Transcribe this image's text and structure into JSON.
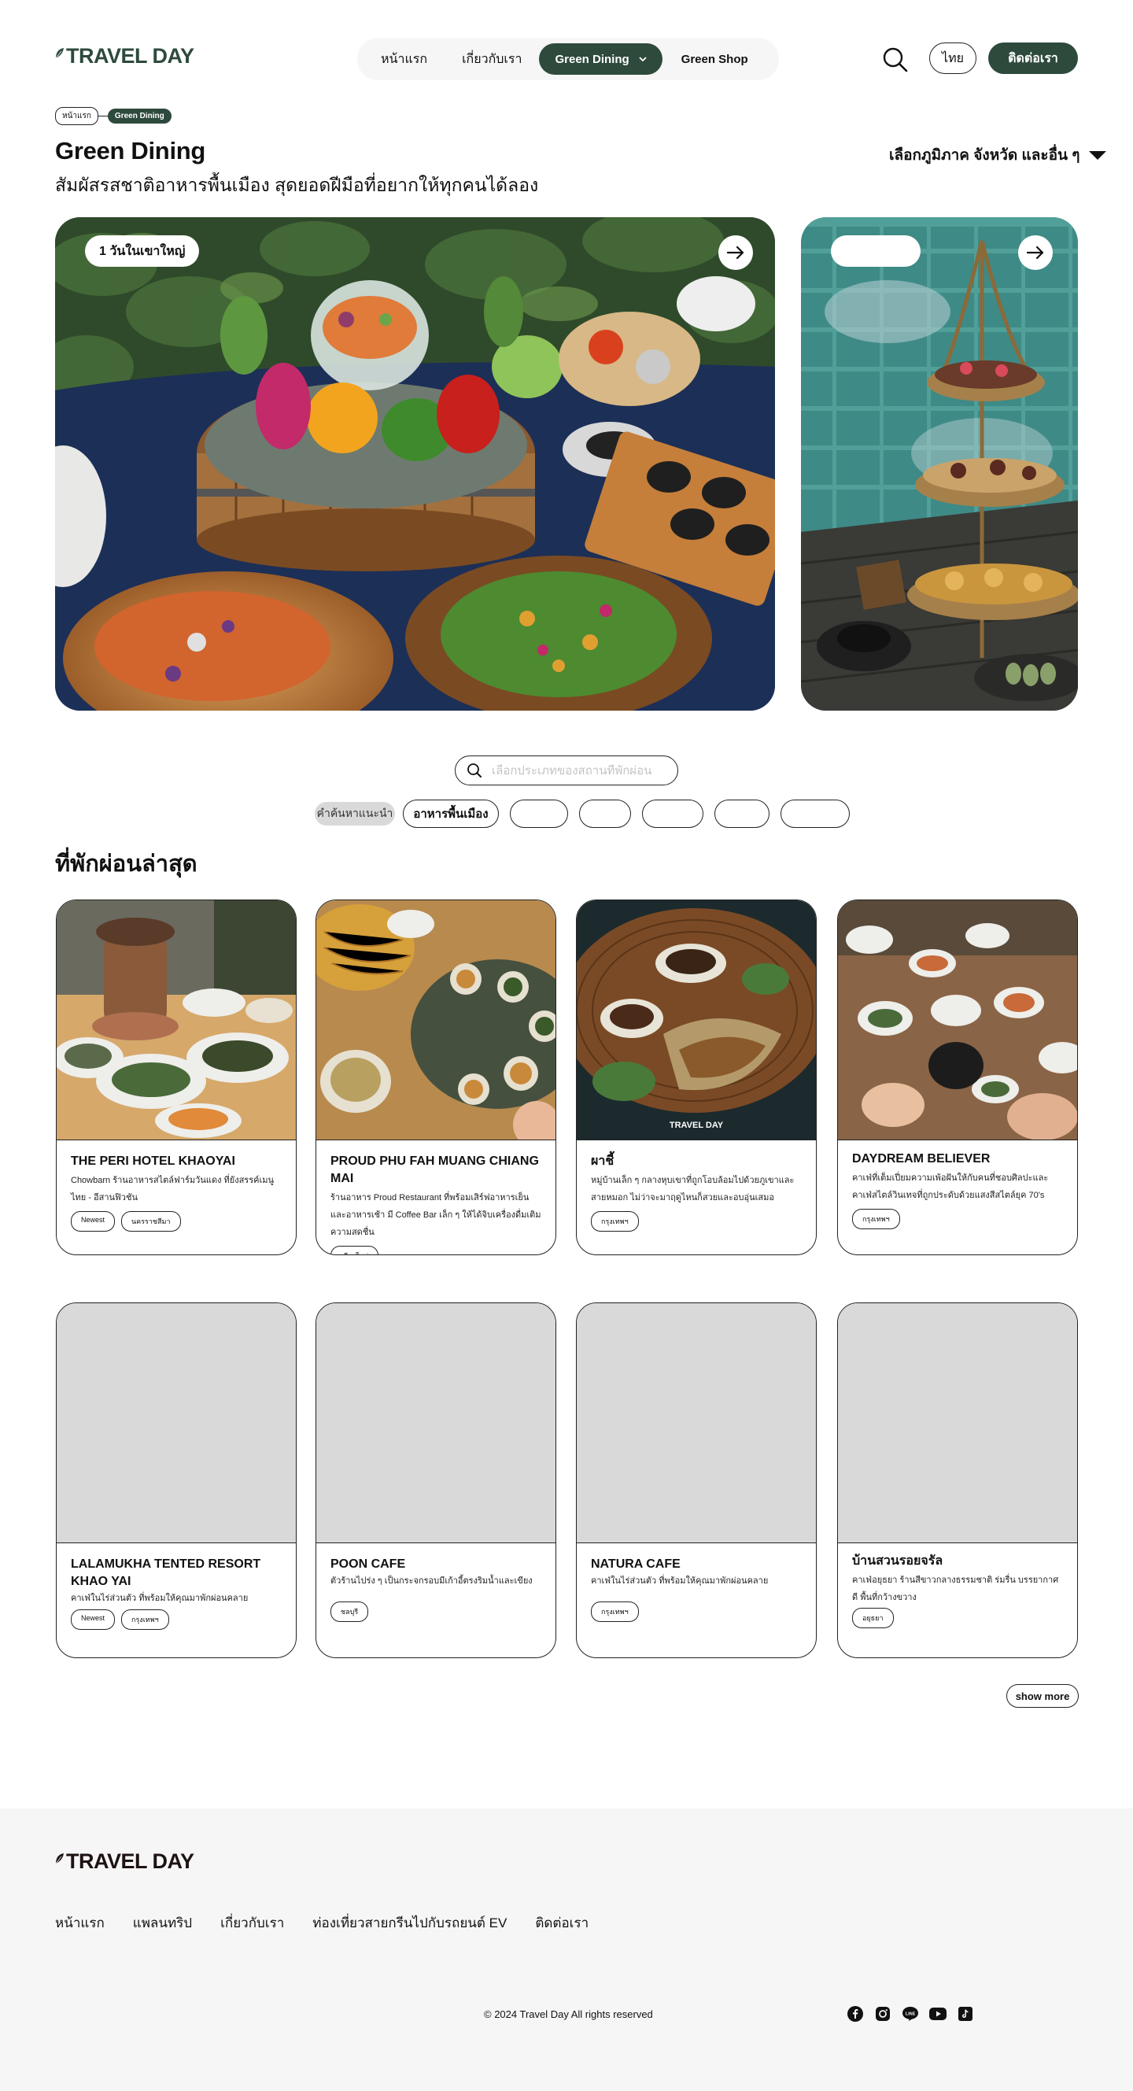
{
  "brand": {
    "name": "TRAVEL DAY",
    "color": "#2d4a3c"
  },
  "nav": {
    "items": [
      "หน้าแรก",
      "เกี่ยวกับเรา"
    ],
    "active": "Green Dining",
    "shop": "Green Shop"
  },
  "header": {
    "lang": "ไทย",
    "contact": "ติดต่อเรา"
  },
  "breadcrumb": {
    "home": "หน้าแรก",
    "current": "Green Dining"
  },
  "page": {
    "title": "Green Dining",
    "subtitle": "สัมผัสรสชาติอาหารพื้นเมือง สุดยอดฝีมือที่อยากให้ทุกคนได้ลอง",
    "region_select": "เลือกภูมิภาค จังหวัด และอื่น ๆ"
  },
  "hero": [
    {
      "label": "1 วันในเขาใหญ่"
    },
    {
      "label": ""
    }
  ],
  "search": {
    "placeholder": "เลือกประเภทของสถานที่พักผ่อน"
  },
  "filters": {
    "label": "คำค้นหาแนะนำ",
    "chips": [
      "อาหารพื้นเมือง",
      "",
      "",
      "",
      "",
      ""
    ]
  },
  "section": {
    "title": "ที่พักผ่อนล่าสุด"
  },
  "cards": [
    {
      "name": "THE PERI HOTEL KHAOYAI",
      "desc": "Chowbarn ร้านอาหารสไตล์ฟาร์มวันแดง ที่ยังสรรค์เมนูไทย - อีสานฟิวชัน",
      "tags": [
        "Newest",
        "นครราชสีมา"
      ]
    },
    {
      "name": "PROUD PHU FAH MUANG CHIANG MAI",
      "desc": "ร้านอาหาร Proud Restaurant ที่พร้อมเสิร์ฟอาหารเย็นและอาหารเช้า มี Coffee Bar เล็ก ๆ ให้ได้จิบเครื่องดื่มเติมความสดชื่น",
      "tags": [
        "เชียงใหม่"
      ]
    },
    {
      "name": "ผาชี้",
      "desc": "หมู่บ้านเล็ก ๆ กลางหุบเขาที่ถูกโอบล้อมไปด้วยภูเขาและสายหมอก ไม่ว่าจะมาฤดูไหนก็สวยและอบอุ่นเสมอ",
      "tags": [
        "กรุงเทพฯ"
      ],
      "overlay": "TRAVEL DAY"
    },
    {
      "name": "DAYDREAM BELIEVER",
      "desc": "คาเฟ่ที่เต็มเปี่ยมความเพ้อฝันให้กับคนที่ชอบศิลปะและคาเฟ่สไตล์วินเทจที่ถูกประดับด้วยแสงสีสไตล์ยุค 70's",
      "tags": [
        "กรุงเทพฯ"
      ]
    },
    {
      "name": "LALAMUKHA TENTED RESORT KHAO YAI",
      "desc": "คาเฟ่ในไร่ส่วนตัว ที่พร้อมให้คุณมาพักผ่อนคลาย",
      "tags": [
        "Newest",
        "กรุงเทพฯ"
      ]
    },
    {
      "name": "POON CAFE",
      "desc": "ตัวร้านไปร่ง ๆ เป็นกระจกรอบมีเก้าอี้ตรงริมน้ำและเขียง",
      "tags": [
        "ชลบุรี"
      ]
    },
    {
      "name": "NATURA CAFE",
      "desc": "คาเฟ่ในไร่ส่วนตัว ที่พร้อมให้คุณมาพักผ่อนคลาย",
      "tags": [
        "กรุงเทพฯ"
      ]
    },
    {
      "name": "บ้านสวนรอยจรัล",
      "desc": "คาเฟ่อยุธยา ร้านสีขาวกลางธรรมชาติ ร่มรื่น บรรยากาศดี พื้นที่กว้างขวาง",
      "tags": [
        "อยุธยา"
      ]
    }
  ],
  "show_more": "show more",
  "footer": {
    "links": [
      "หน้าแรก",
      "แพลนทริป",
      "เกี่ยวกับเรา",
      "ท่องเที่ยวสายกรีนไปกับรถยนต์ EV",
      "ติดต่อเรา"
    ],
    "copyright": "© 2024 Travel Day All rights reserved",
    "socials": [
      "facebook-icon",
      "instagram-icon",
      "line-icon",
      "youtube-icon",
      "tiktok-icon"
    ]
  }
}
